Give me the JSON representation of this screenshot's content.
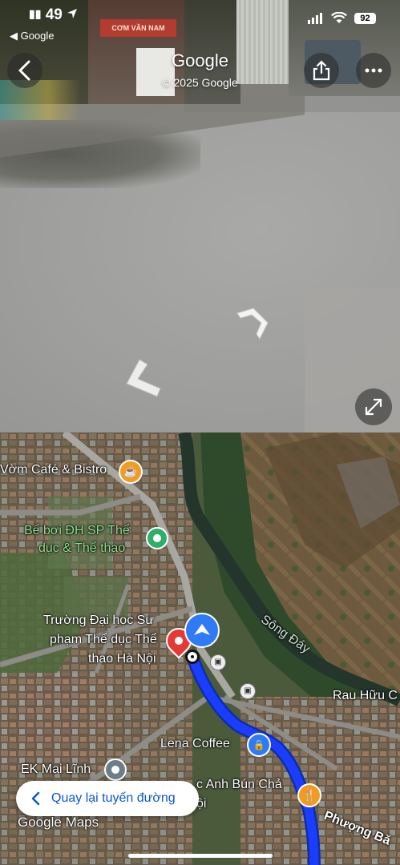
{
  "status_bar": {
    "time": "49",
    "back_app": "◀ Google",
    "battery": "92"
  },
  "street_view": {
    "title": "Google",
    "copyright": "© 2025 Google",
    "shop_sign": "CƠM VĂN NAM"
  },
  "map": {
    "places": [
      {
        "label": "Vờm Café & Bistro"
      },
      {
        "label": "Bể bơi ĐH SP Thể"
      },
      {
        "label": "dục & Thể thao"
      },
      {
        "label": "Trường Đại học Sư"
      },
      {
        "label": "phạm Thể dục Thể"
      },
      {
        "label": "thao Hà Nội"
      },
      {
        "label": "Sông Đáy"
      },
      {
        "label": "Rau Hữu C"
      },
      {
        "label": "Lena Coffee"
      },
      {
        "label": "EK Mai Lĩnh"
      },
      {
        "label": "c Anh Bún Chả"
      },
      {
        "label": "ội"
      },
      {
        "label": "Phượng Bă"
      }
    ],
    "back_to_route": "Quay lại tuyến đường",
    "logo_google": "Google",
    "logo_maps": "Maps"
  },
  "colors": {
    "route": "#1a3dff",
    "back_text": "#0b57d0",
    "green_label": "#8ee28e",
    "orange_pin": "#f29b23",
    "blue_pin": "#2f7bf5"
  }
}
